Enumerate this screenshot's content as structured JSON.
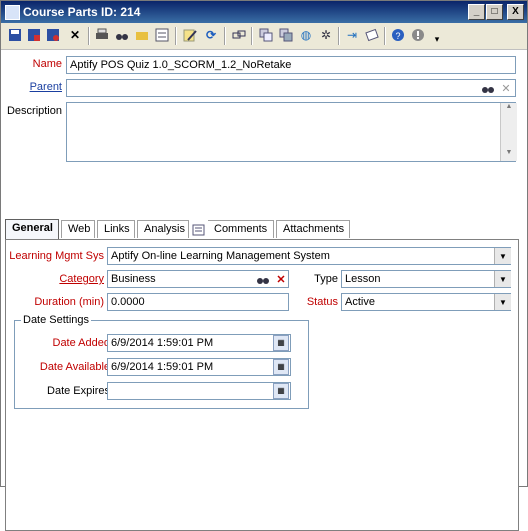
{
  "window": {
    "title": "Course Parts ID: 214",
    "controls": [
      "_",
      "□",
      "X"
    ]
  },
  "toolbar": {
    "icons": [
      "save-icon",
      "save-new-icon",
      "save-close-icon",
      "delete-icon",
      "print-icon",
      "find-icon",
      "open-folder-icon",
      "list-icon",
      "edit-icon",
      "refresh-icon",
      "link-icon",
      "copy-icon",
      "copy-record-icon",
      "globe-icon",
      "spinner-icon",
      "import-icon",
      "attach-icon",
      "help-icon",
      "info-icon",
      "more-icon"
    ]
  },
  "form": {
    "name_label": "Name",
    "name_value": "Aptify POS Quiz 1.0_SCORM_1.2_NoRetake",
    "parent_label": "Parent",
    "parent_value": "",
    "description_label": "Description",
    "description_value": ""
  },
  "tabs": [
    "General",
    "Web",
    "Links",
    "Analysis",
    "Comments",
    "Attachments"
  ],
  "general": {
    "lms_label": "Learning Mgmt Sys",
    "lms_value": "Aptify On-line Learning Management System",
    "category_label": "Category",
    "category_value": "Business",
    "type_label": "Type",
    "type_value": "Lesson",
    "duration_label": "Duration (min)",
    "duration_value": "0.0000",
    "status_label": "Status",
    "status_value": "Active",
    "date_settings_label": "Date Settings",
    "date_added_label": "Date Added",
    "date_added_value": "6/9/2014 1:59:01 PM",
    "date_available_label": "Date Available",
    "date_available_value": "6/9/2014 1:59:01 PM",
    "date_expires_label": "Date Expires",
    "date_expires_value": ""
  }
}
